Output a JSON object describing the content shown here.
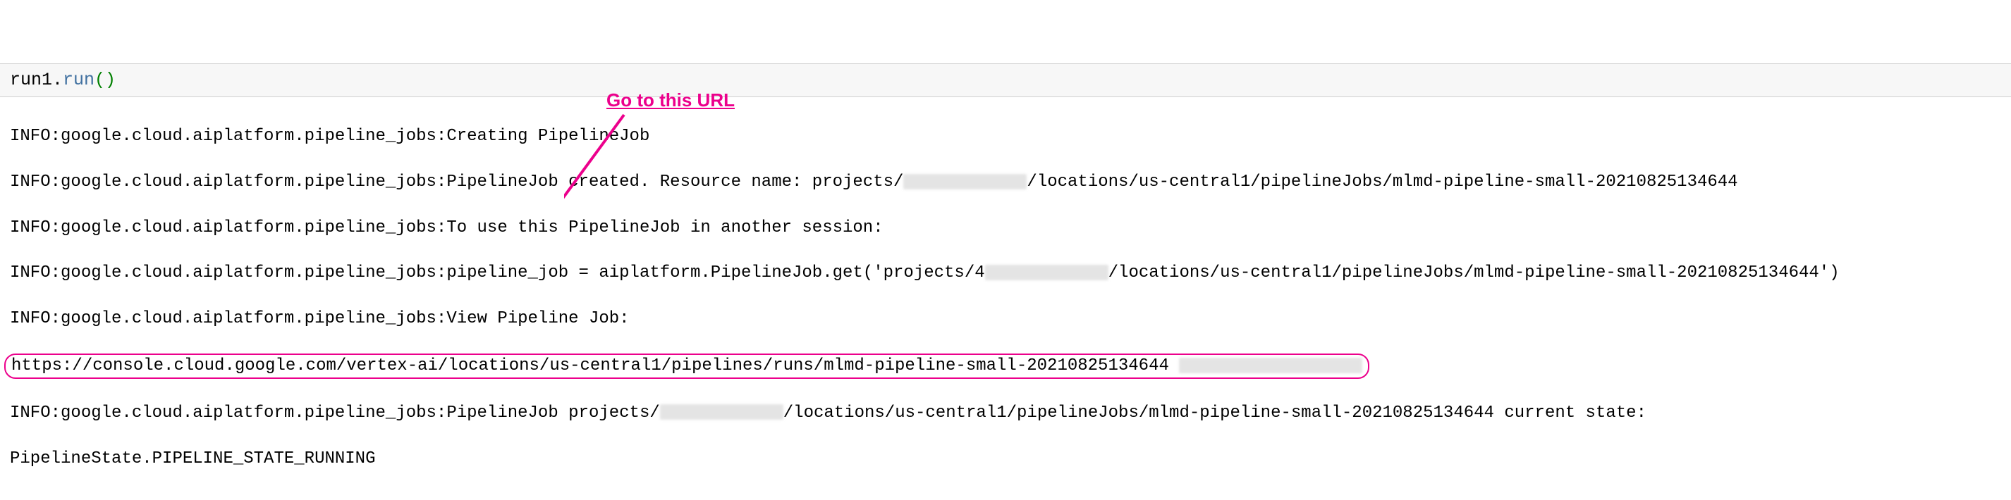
{
  "annotation": {
    "label": "Go to this URL",
    "color": "#ec008c"
  },
  "code": {
    "object": "run1",
    "method": "run",
    "parens": "()"
  },
  "log": {
    "prefix": "INFO:google.cloud.aiplatform.pipeline_jobs:",
    "line1": "Creating PipelineJob",
    "line2_pre": "PipelineJob created. Resource name: projects/",
    "line2_post": "/locations/us-central1/pipelineJobs/mlmd-pipeline-small-20210825134644",
    "line3": "To use this PipelineJob in another session:",
    "line4_pre": "pipeline_job = aiplatform.PipelineJob.get('projects/4",
    "line4_post": "/locations/us-central1/pipelineJobs/mlmd-pipeline-small-20210825134644')",
    "line5": "View Pipeline Job:",
    "url": "https://console.cloud.google.com/vertex-ai/locations/us-central1/pipelines/runs/mlmd-pipeline-small-20210825134644",
    "line7_pre": "PipelineJob projects/",
    "line7_post": "/locations/us-central1/pipelineJobs/mlmd-pipeline-small-20210825134644 current state:",
    "line8": "PipelineState.PIPELINE_STATE_RUNNING"
  }
}
